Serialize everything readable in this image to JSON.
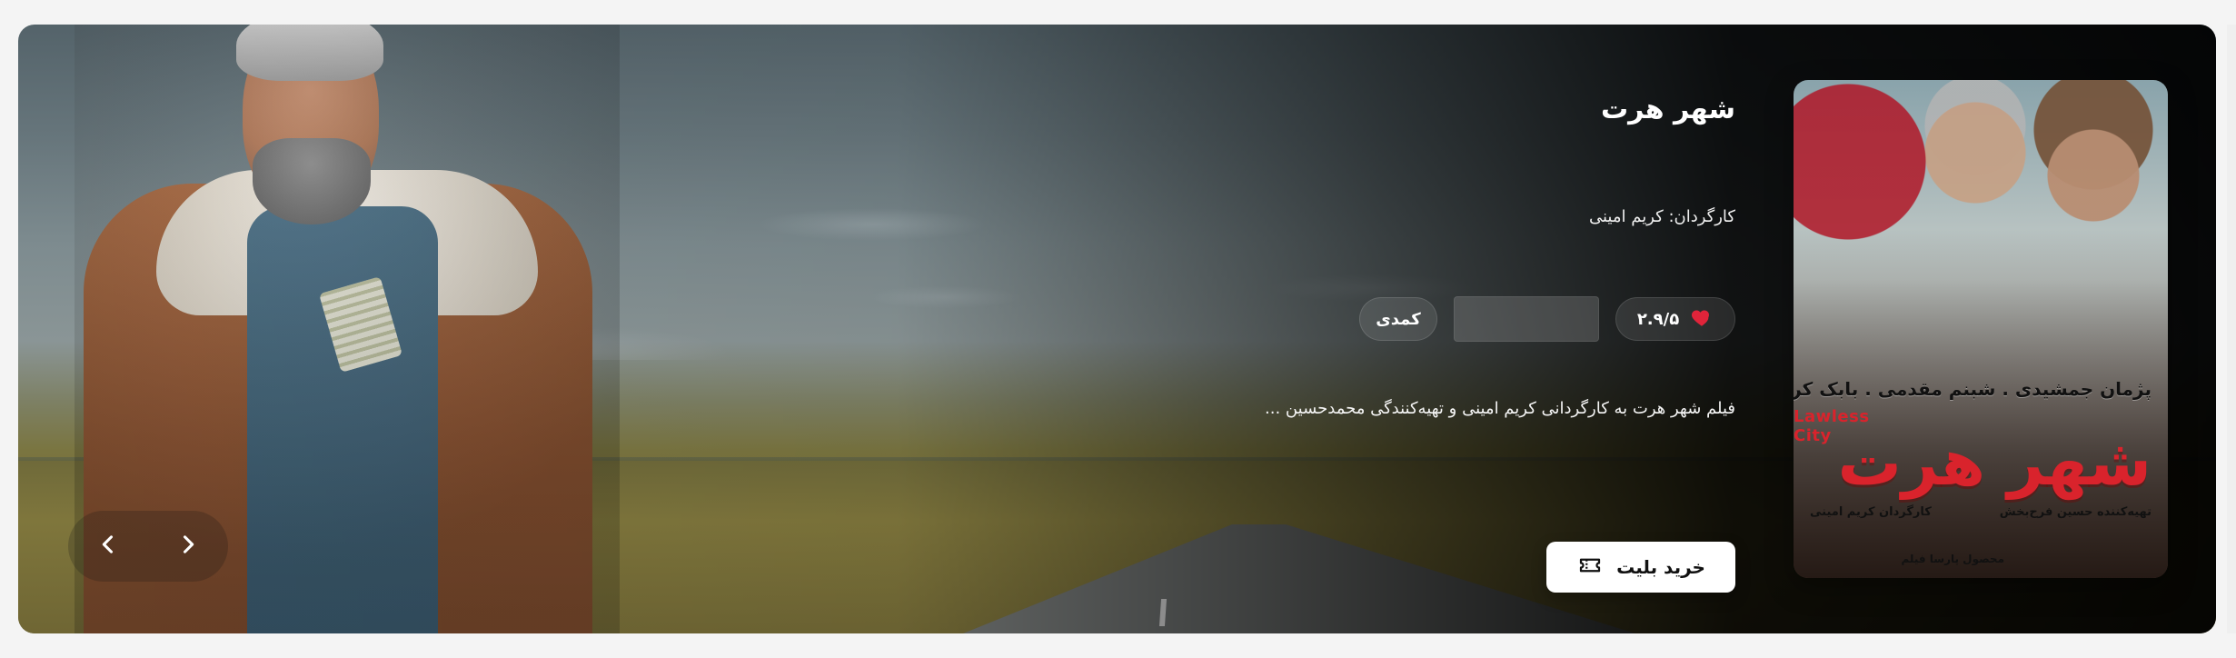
{
  "movie": {
    "title": "شهر هرت",
    "director_line": "کارگردان: کریم امینی",
    "rating": "۲.۹/۵",
    "genre": "کمدی",
    "summary": "فیلم شهر هرت به کارگردانی کریم امینی و تهیه‌کنندگی محمدحسین ..."
  },
  "buttons": {
    "buy_ticket": "خرید بلیت"
  },
  "poster": {
    "cast": "پژمان جمشیدی . شبنم مقدمی . بابک کریمی",
    "logo": "شهر هرت",
    "english_title": "Lawless City",
    "producer_credit": "تهیه‌کننده حسین فرح‌بخش",
    "director_credit": "کارگردان کریم امینی",
    "distributor": "محصول پارسا فیلم"
  },
  "icons": {
    "heart": "heart-icon",
    "ticket": "ticket-icon",
    "prev": "chevron-left-icon",
    "next": "chevron-right-icon"
  },
  "colors": {
    "heart": "#e0243a",
    "button_bg": "#ffffff",
    "text": "#ffffff"
  }
}
